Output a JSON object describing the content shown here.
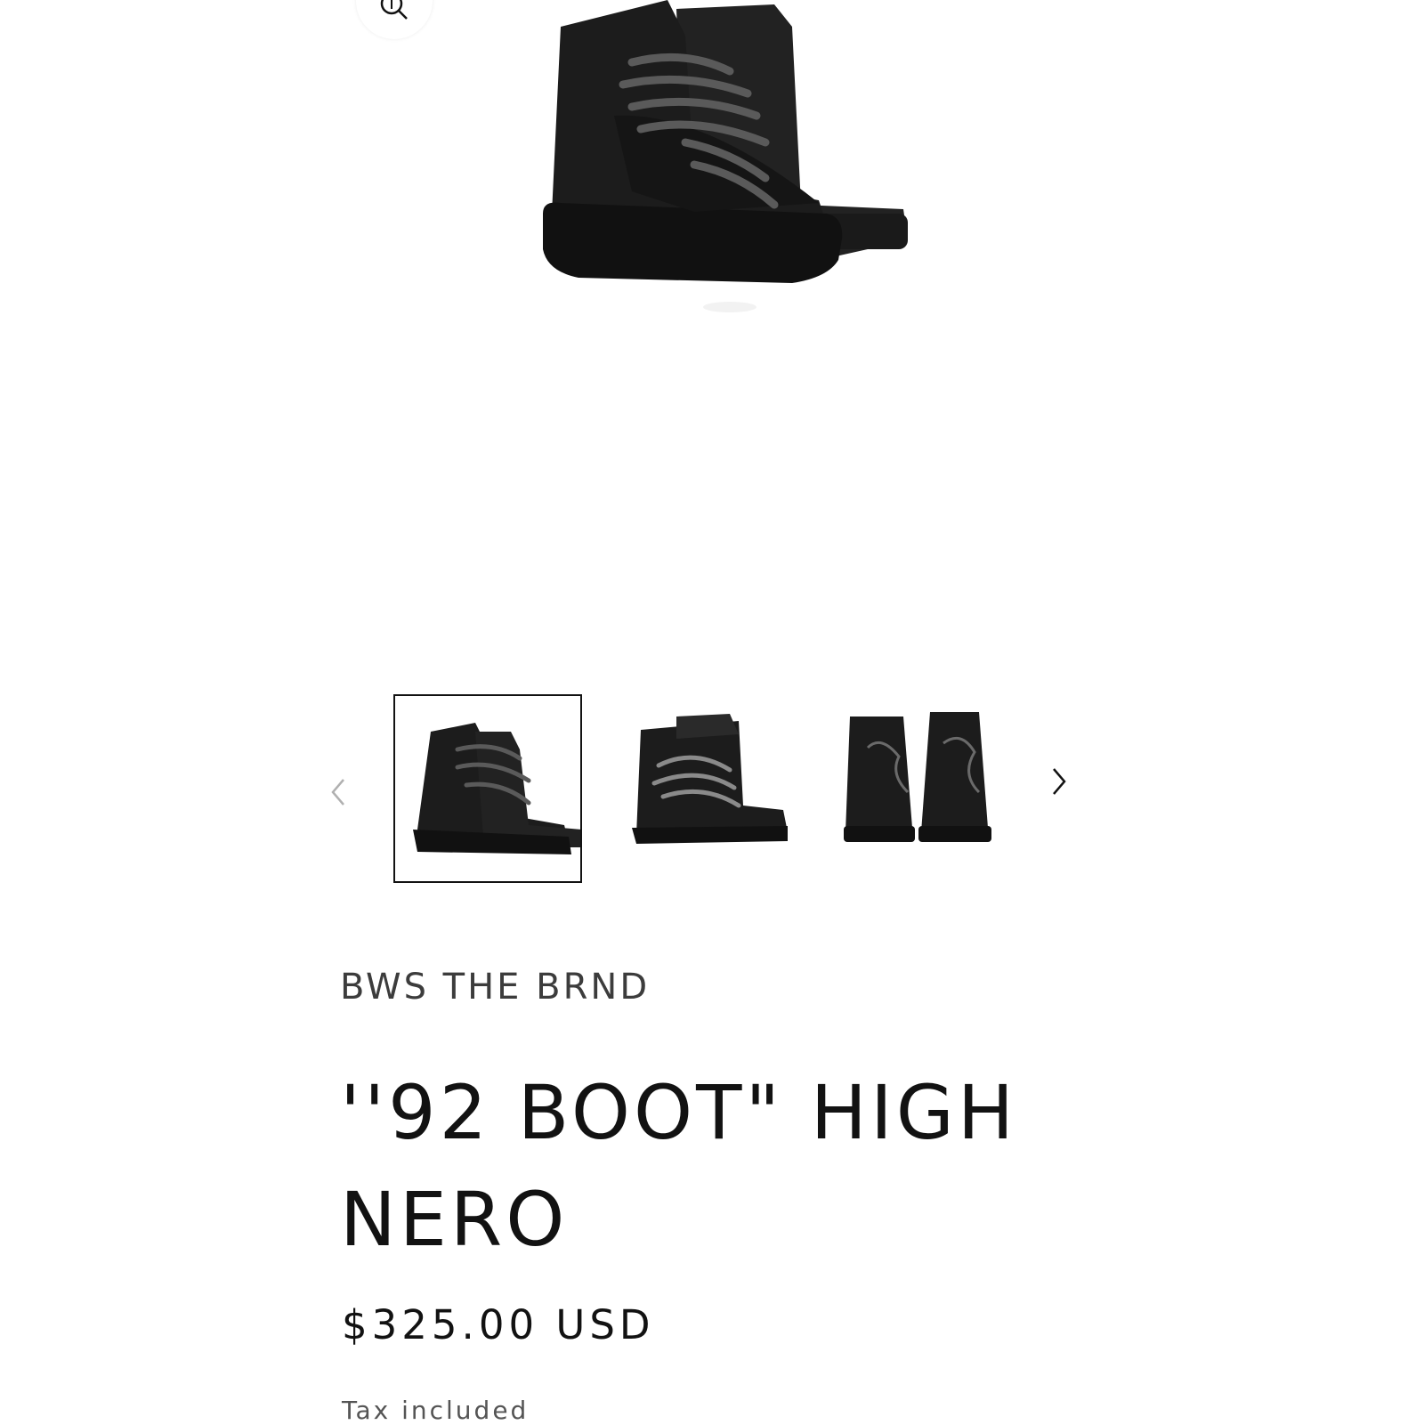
{
  "gallery": {
    "zoom_icon": "zoom-magnifier-icon",
    "prev_icon": "chevron-left-icon",
    "next_icon": "chevron-right-icon",
    "active_thumbnail": 1,
    "thumbnail_count": 3
  },
  "product": {
    "vendor": "BWS THE BRND",
    "title": "''92 BOOT\" HIGH NERO",
    "price": "$325.00 USD",
    "tax_note": "Tax included"
  },
  "colors": {
    "text": "#121212",
    "vendor": "#3c3c3c",
    "boot": "#1c1c1c",
    "lace": "#5a5a5a"
  }
}
